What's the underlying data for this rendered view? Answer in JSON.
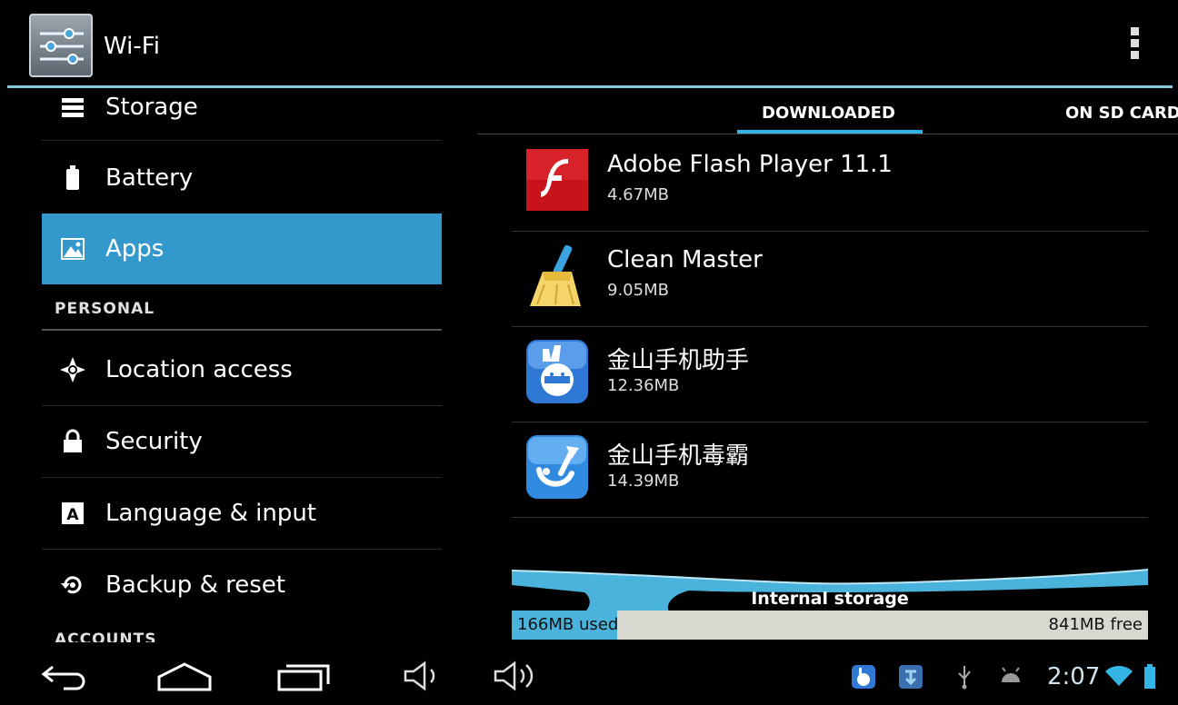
{
  "action_bar": {
    "title": "Wi-Fi",
    "app_icon": "settings-sliders-icon",
    "overflow_icon": "overflow-menu-icon"
  },
  "settings": {
    "items": [
      {
        "label": "Storage",
        "icon": "storage-icon"
      },
      {
        "label": "Battery",
        "icon": "battery-icon"
      },
      {
        "label": "Apps",
        "icon": "apps-icon",
        "selected": true
      }
    ],
    "personal_header": "PERSONAL",
    "personal_items": [
      {
        "label": "Location access",
        "icon": "location-icon"
      },
      {
        "label": "Security",
        "icon": "lock-icon"
      },
      {
        "label": "Language & input",
        "icon": "language-icon"
      },
      {
        "label": "Backup & reset",
        "icon": "backup-icon"
      }
    ],
    "accounts_header": "ACCOUNTS"
  },
  "tabs": {
    "downloaded": "DOWNLOADED",
    "sd_card": "ON SD CARD",
    "active": "DOWNLOADED"
  },
  "apps": [
    {
      "name": "Adobe Flash Player 11.1",
      "size": "4.67MB",
      "icon": "flash-player-icon"
    },
    {
      "name": "Clean Master",
      "size": "9.05MB",
      "icon": "broom-icon"
    },
    {
      "name": "金山手机助手",
      "size": "12.36MB",
      "icon": "kingsoft-assistant-icon"
    },
    {
      "name": "金山手机毒霸",
      "size": "14.39MB",
      "icon": "kingsoft-antivirus-icon"
    }
  ],
  "storage": {
    "label": "Internal storage",
    "used": "166MB used",
    "free": "841MB free",
    "used_fraction": 0.165
  },
  "navbar": {
    "buttons": [
      "back-icon",
      "home-icon",
      "recent-apps-icon",
      "volume-down-icon",
      "volume-up-icon"
    ],
    "clock": "2:07",
    "colors": {
      "accent": "#33b5e5",
      "selected": "#3399cc"
    }
  }
}
